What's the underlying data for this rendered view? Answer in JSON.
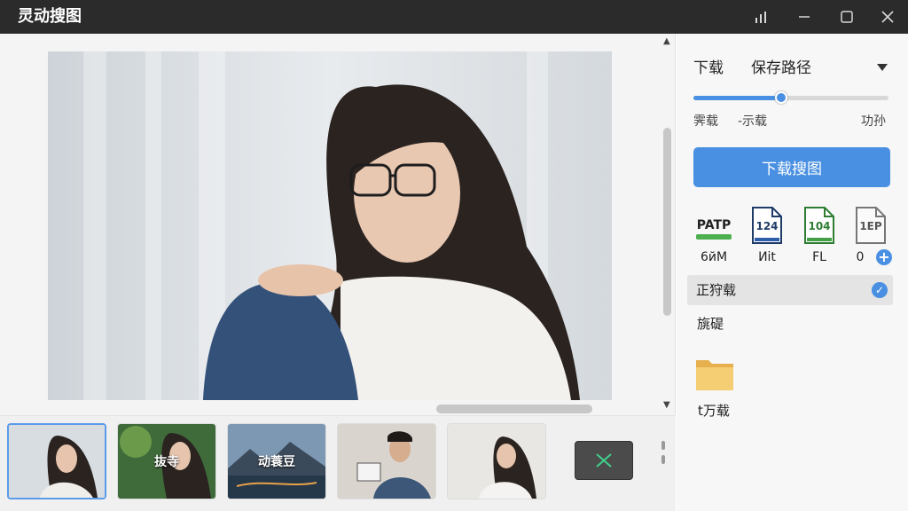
{
  "app": {
    "title": "灵动搜图"
  },
  "window_controls": {
    "minimize": "minimize",
    "maximize": "maximize",
    "close": "close",
    "extra": "signal"
  },
  "preview": {
    "scroll_up": "▲",
    "scroll_down": "▼"
  },
  "filmstrip": {
    "items": [
      {
        "caption": "",
        "selected": true
      },
      {
        "caption": "抜寺",
        "selected": false
      },
      {
        "caption": "动蓑豆",
        "selected": false
      },
      {
        "caption": "",
        "selected": false
      },
      {
        "caption": "",
        "selected": false
      }
    ]
  },
  "panel": {
    "download_label": "下载",
    "save_path_label": "保存路径",
    "slider": {
      "value": 0.45
    },
    "quality_left": "霁载",
    "quality_mid": "-示载",
    "quality_right": "功孙",
    "primary_button": "下载搜图",
    "formats": [
      {
        "name": "PATP",
        "size": "6йM"
      },
      {
        "name": "124",
        "size": "Иit"
      },
      {
        "name": "104",
        "size": "FL"
      },
      {
        "name": "1ΕΡ",
        "size": "0"
      }
    ],
    "status_text": "正狩载",
    "sub_status": "旐碮",
    "folder_label": "t万载"
  },
  "colors": {
    "accent": "#4a90e2",
    "titlebar": "#2b2b2b"
  }
}
